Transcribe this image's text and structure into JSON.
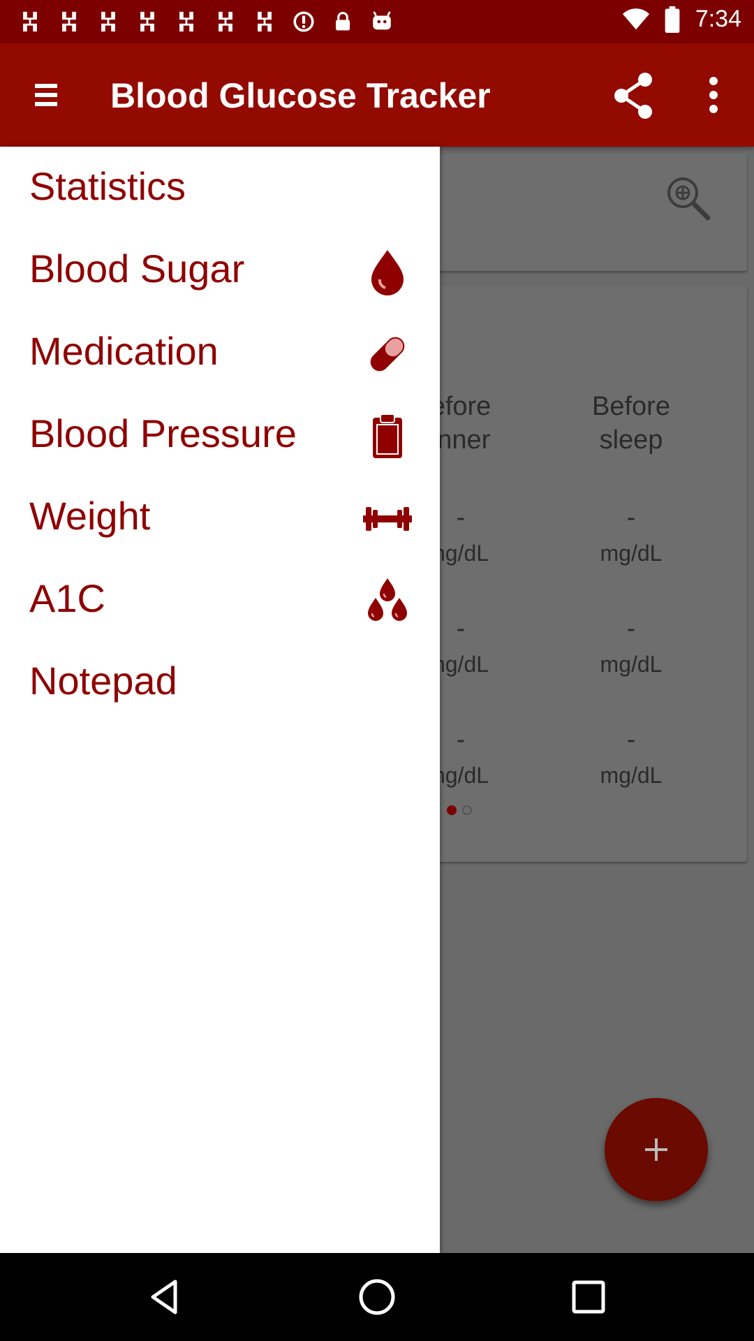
{
  "status_bar": {
    "time": "7:34",
    "icons": [
      "news-icon",
      "news-icon",
      "news-icon",
      "news-icon",
      "news-icon",
      "news-icon",
      "news-icon",
      "block-icon",
      "lock-icon",
      "android-icon",
      "wifi-icon",
      "battery-icon"
    ]
  },
  "app_bar": {
    "title": "Blood Glucose Tracker",
    "icons": [
      "menu-icon",
      "share-icon",
      "more-vert-icon"
    ]
  },
  "drawer": {
    "items": [
      {
        "label": "Statistics",
        "icon": ""
      },
      {
        "label": "Blood Sugar",
        "icon": "blood-drop-icon"
      },
      {
        "label": "Medication",
        "icon": "pill-icon"
      },
      {
        "label": "Blood Pressure",
        "icon": "clipboard-icon"
      },
      {
        "label": "Weight",
        "icon": "dumbbell-icon"
      },
      {
        "label": "A1C",
        "icon": "three-drops-icon"
      },
      {
        "label": "Notepad",
        "icon": ""
      }
    ]
  },
  "background": {
    "columns": [
      {
        "head_line1": "efore",
        "head_line2": "inner",
        "values": [
          "-",
          "-",
          "-"
        ],
        "units": [
          "ng/dL",
          "ng/dL",
          "ng/dL"
        ]
      },
      {
        "head_line1": "Before",
        "head_line2": "sleep",
        "values": [
          "-",
          "-",
          "-"
        ],
        "units": [
          "mg/dL",
          "mg/dL",
          "mg/dL"
        ]
      }
    ],
    "pager": {
      "current": 1,
      "total": 2
    }
  },
  "fab": {
    "icon": "plus-icon"
  },
  "nav_bar": {
    "icons": [
      "back-icon",
      "home-icon",
      "recents-icon"
    ]
  },
  "colors": {
    "primary": "#930a00",
    "status": "#7d0000",
    "accent": "#8f0000",
    "fab": "#6a0a00"
  }
}
